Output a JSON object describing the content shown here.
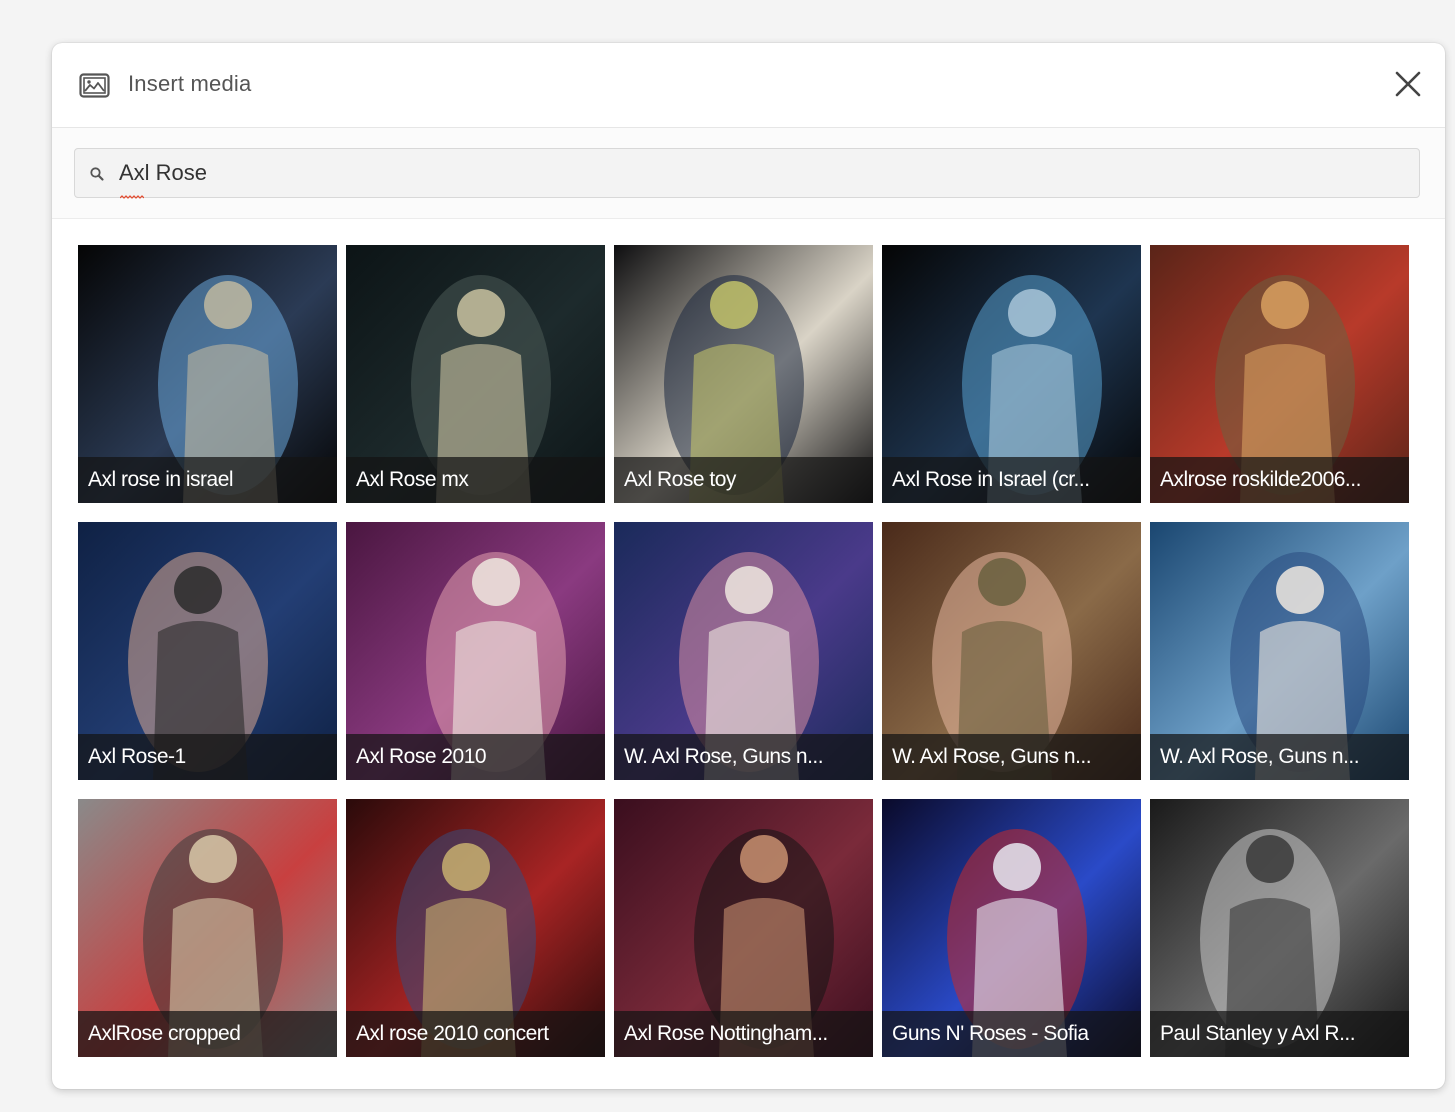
{
  "dialog": {
    "title": "Insert media",
    "header_icon": "image-icon",
    "close_icon": "close-icon"
  },
  "search": {
    "icon": "search-icon",
    "value": "Axl Rose"
  },
  "results": [
    {
      "caption": "Axl rose in israel",
      "palette": [
        "#050505",
        "#2b3b55",
        "#6aa6d8",
        "#c0b8a0"
      ]
    },
    {
      "caption": "Axl Rose mx",
      "palette": [
        "#0c1416",
        "#1d2a2c",
        "#4b5a55",
        "#c9c2a0"
      ]
    },
    {
      "caption": "Axl Rose toy",
      "palette": [
        "#0e0e10",
        "#d9d3c6",
        "#1b2840",
        "#c2c26a"
      ]
    },
    {
      "caption": "Axl Rose in Israel (cr...",
      "palette": [
        "#050505",
        "#1e3550",
        "#58a0d0",
        "#a9c6d8"
      ]
    },
    {
      "caption": "Axlrose roskilde2006...",
      "palette": [
        "#5a2418",
        "#b83a2a",
        "#6b6040",
        "#d8a060"
      ]
    },
    {
      "caption": "Axl Rose-1",
      "palette": [
        "#0f2144",
        "#233e74",
        "#d8a890",
        "#2b2b2b"
      ]
    },
    {
      "caption": "Axl Rose 2010",
      "palette": [
        "#4a1640",
        "#8a3a80",
        "#e4a0ae",
        "#efe7df"
      ]
    },
    {
      "caption": "W. Axl Rose, Guns n...",
      "palette": [
        "#1a2a5a",
        "#4a3a8a",
        "#d88ea0",
        "#efe7df"
      ]
    },
    {
      "caption": "W. Axl Rose, Guns n...",
      "palette": [
        "#4a2a1a",
        "#8a6a48",
        "#e8b8a0",
        "#6a6040"
      ]
    },
    {
      "caption": "W. Axl Rose, Guns n...",
      "palette": [
        "#1a4670",
        "#6ea0c8",
        "#2a4a80",
        "#efe7df"
      ]
    },
    {
      "caption": "AxlRose cropped",
      "palette": [
        "#8a8a8a",
        "#c84040",
        "#3a3a3a",
        "#d8c8a8"
      ]
    },
    {
      "caption": "Axl rose 2010 concert",
      "palette": [
        "#2a0a0a",
        "#a82424",
        "#3a4a7a",
        "#c8b070"
      ]
    },
    {
      "caption": "Axl Rose Nottingham...",
      "palette": [
        "#3a0e1e",
        "#7a2a3a",
        "#141414",
        "#c89070"
      ]
    },
    {
      "caption": "Guns N' Roses - Sofia",
      "palette": [
        "#0a0a2a",
        "#2a4ac8",
        "#c82a2a",
        "#e8e8f0"
      ]
    },
    {
      "caption": "Paul Stanley y Axl R...",
      "palette": [
        "#1a1a1a",
        "#6a6a6a",
        "#c8c8c8",
        "#3a3a3a"
      ]
    }
  ]
}
